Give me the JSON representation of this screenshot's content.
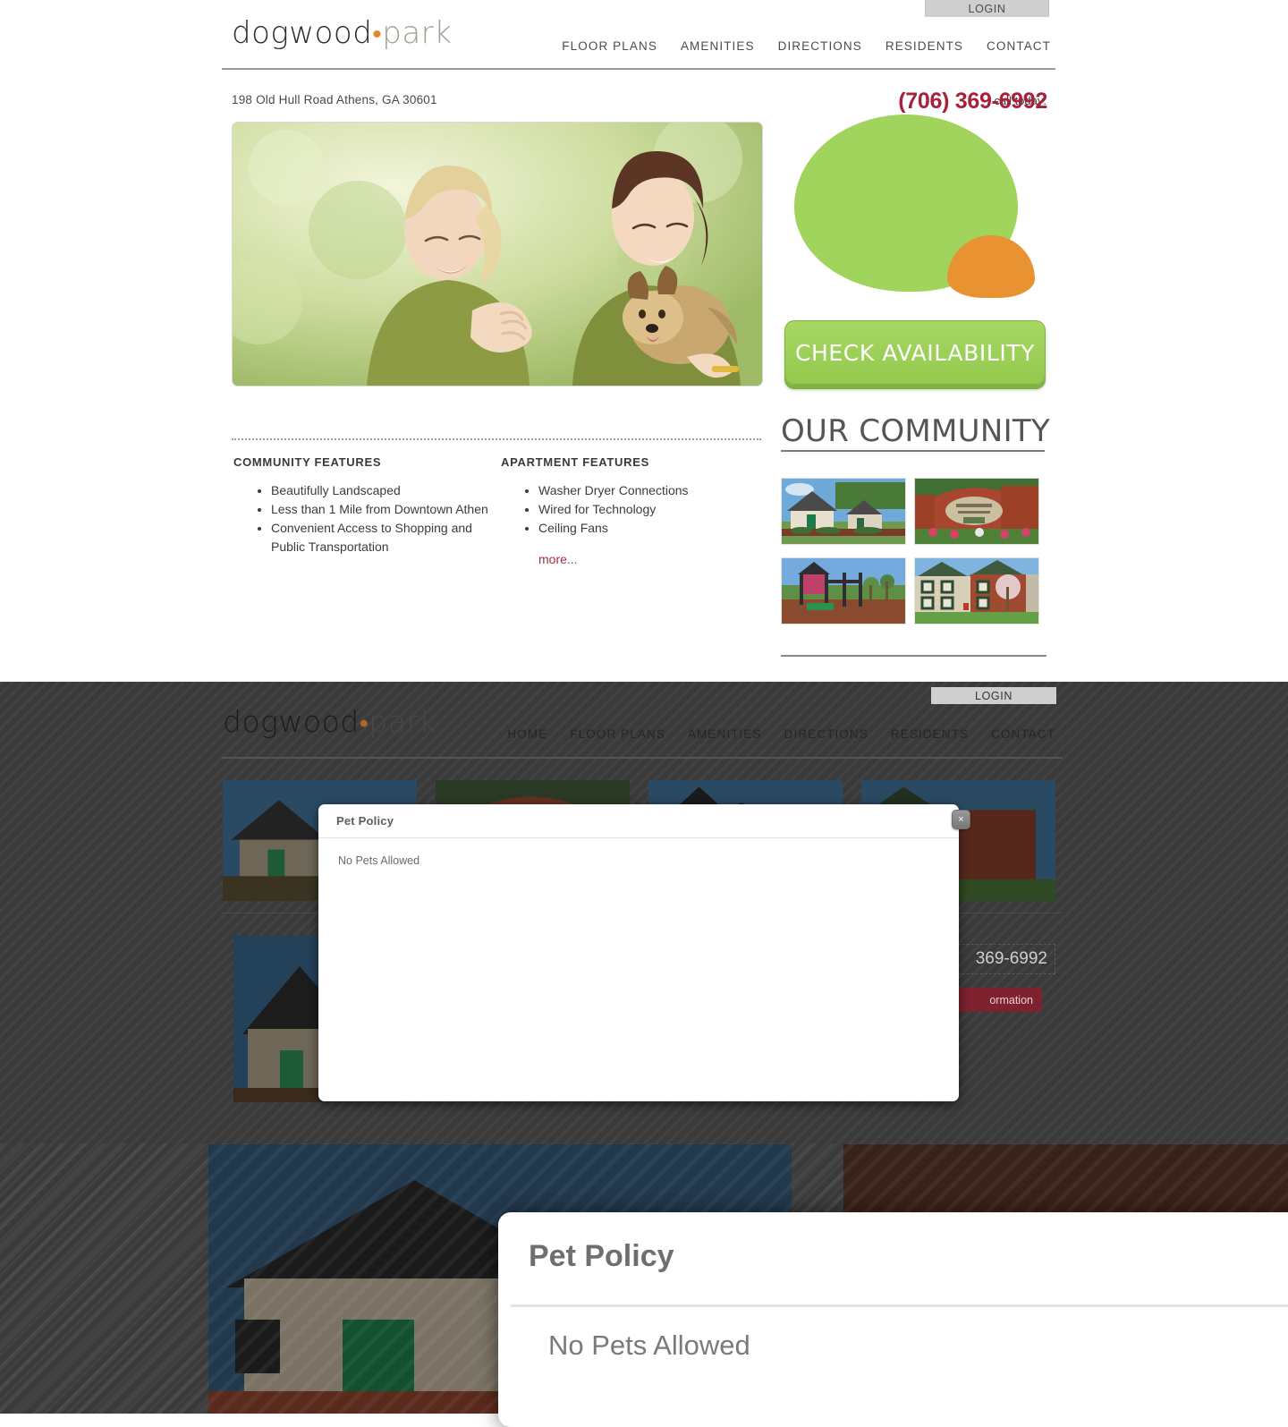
{
  "brand": {
    "word1": "dogwood",
    "separator": "•",
    "word2": "park"
  },
  "topbar": {
    "login_label": "LOGIN"
  },
  "nav_light": {
    "items": [
      "FLOOR PLANS",
      "AMENITIES",
      "DIRECTIONS",
      "RESIDENTS",
      "CONTACT"
    ]
  },
  "nav_dark": {
    "items": [
      "HOME",
      "FLOOR PLANS",
      "AMENITIES",
      "DIRECTIONS",
      "RESIDENTS",
      "CONTACT"
    ]
  },
  "contact": {
    "address": "198 Old Hull Road Athens, GA 30601",
    "call_label": "call today:",
    "phone": "(706) 369-6992"
  },
  "cta": {
    "check_availability": "CHECK AVAILABILITY"
  },
  "features": {
    "community": {
      "title": "COMMUNITY FEATURES",
      "items": [
        "Beautifully Landscaped",
        "Less than 1 Mile from Downtown Athen",
        "Convenient Access to Shopping and Public Transportation"
      ]
    },
    "apartment": {
      "title": "APARTMENT FEATURES",
      "items": [
        "Washer Dryer Connections",
        "Wired for Technology",
        "Ceiling Fans"
      ],
      "more_label": "more..."
    }
  },
  "community": {
    "title": "OUR COMMUNITY",
    "thumbnails": [
      "ranch-building-photo",
      "brick-entrance-sign-photo",
      "playground-photo",
      "two-story-building-photo"
    ]
  },
  "hero": {
    "alt": "two-women-with-dog-photo"
  },
  "modal": {
    "title": "Pet Policy",
    "body": "No Pets Allowed",
    "close_label": "×"
  },
  "modal_zoomed": {
    "title": "Pet Policy",
    "body": "No Pets Allowed"
  },
  "dark_section": {
    "phone_partial": "369-6992",
    "request_button_partial": "ormation"
  },
  "colors": {
    "green": "#a0d45c",
    "orange": "#e89232",
    "phone_red": "#a62139",
    "link_red": "#a33041",
    "dark_bg": "#3a3a3a"
  }
}
